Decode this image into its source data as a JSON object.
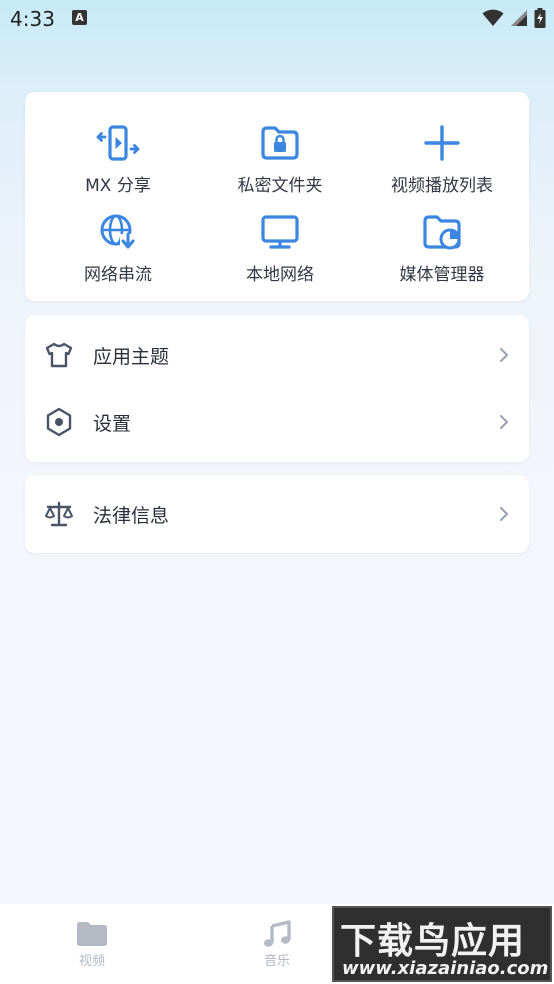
{
  "status_bar": {
    "time": "4:33",
    "notification_badge": "A"
  },
  "colors": {
    "accent": "#3a86e0",
    "row_icon": "#4a5467",
    "nav_inactive": "#b4b9c4"
  },
  "grid": {
    "items": [
      {
        "label": "MX 分享",
        "icon": "share-icon"
      },
      {
        "label": "私密文件夹",
        "icon": "private-folder-icon"
      },
      {
        "label": "视频播放列表",
        "icon": "plus-icon"
      },
      {
        "label": "网络串流",
        "icon": "network-stream-icon"
      },
      {
        "label": "本地网络",
        "icon": "monitor-icon"
      },
      {
        "label": "媒体管理器",
        "icon": "media-manager-icon"
      }
    ]
  },
  "settings": {
    "items": [
      {
        "label": "应用主题",
        "icon": "shirt-icon"
      },
      {
        "label": "设置",
        "icon": "hexagon-settings-icon"
      }
    ]
  },
  "legal": {
    "items": [
      {
        "label": "法律信息",
        "icon": "scale-icon"
      }
    ]
  },
  "bottom_nav": {
    "items": [
      {
        "label": "视频",
        "icon": "folder-icon"
      },
      {
        "label": "音乐",
        "icon": "music-note-icon"
      }
    ]
  },
  "watermark": {
    "title": "下载鸟应用",
    "url": "www.xiazainiao.com"
  }
}
